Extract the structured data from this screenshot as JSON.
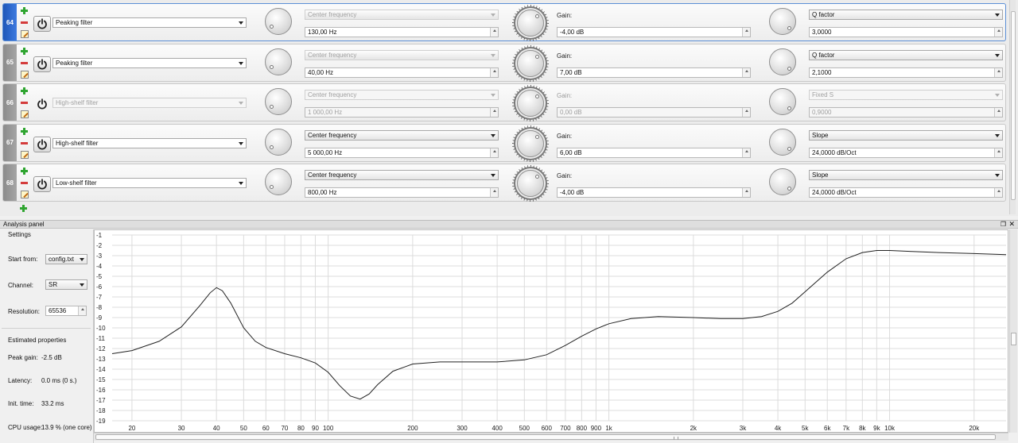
{
  "filters": [
    {
      "index": "64",
      "enabled": true,
      "selected": true,
      "type": "Peaking filter",
      "param1_label": "Center frequency",
      "param1_value": "130,00 Hz",
      "gain_label": "Gain:",
      "gain_value": "-4,00 dB",
      "param3_label": "Q factor",
      "param3_value": "3,0000"
    },
    {
      "index": "65",
      "enabled": true,
      "selected": false,
      "type": "Peaking filter",
      "param1_label": "Center frequency",
      "param1_value": "40,00 Hz",
      "gain_label": "Gain:",
      "gain_value": "7,00 dB",
      "param3_label": "Q factor",
      "param3_value": "2,1000"
    },
    {
      "index": "66",
      "enabled": false,
      "selected": false,
      "type": "High-shelf filter",
      "param1_label": "Center frequency",
      "param1_value": "1 000,00 Hz",
      "gain_label": "Gain:",
      "gain_value": "0,00 dB",
      "param3_label": "Fixed S",
      "param3_value": "0,9000"
    },
    {
      "index": "67",
      "enabled": true,
      "selected": false,
      "type": "High-shelf filter",
      "param1_label": "Center frequency",
      "param1_value": "5 000,00 Hz",
      "gain_label": "Gain:",
      "gain_value": "6,00 dB",
      "param3_label": "Slope",
      "param3_value": "24,0000 dB/Oct"
    },
    {
      "index": "68",
      "enabled": true,
      "selected": false,
      "type": "Low-shelf filter",
      "param1_label": "Center frequency",
      "param1_value": "800,00 Hz",
      "gain_label": "Gain:",
      "gain_value": "-4,00 dB",
      "param3_label": "Slope",
      "param3_value": "24,0000 dB/Oct"
    }
  ],
  "analysis": {
    "title": "Analysis panel",
    "settings_title": "Settings",
    "start_from_label": "Start from:",
    "start_from_value": "config.txt",
    "channel_label": "Channel:",
    "channel_value": "SR",
    "resolution_label": "Resolution:",
    "resolution_value": "65536",
    "estimated_title": "Estimated properties",
    "peak_gain_label": "Peak gain:",
    "peak_gain_value": "-2.5 dB",
    "latency_label": "Latency:",
    "latency_value": "0.0 ms (0 s.)",
    "init_time_label": "Init. time:",
    "init_time_value": "33.2 ms",
    "cpu_label": "CPU usage:",
    "cpu_value": "13.9 % (one core)"
  },
  "colors": {
    "selected_accent": "#2f6fd0",
    "add_green": "#2fa530",
    "remove_red": "#d43c3c"
  },
  "chart_data": {
    "type": "line",
    "x_scale": "log",
    "xlim": [
      17,
      26000
    ],
    "ylim": [
      -19,
      -1
    ],
    "y_ticks": [
      -1,
      -2,
      -3,
      -4,
      -5,
      -6,
      -7,
      -8,
      -9,
      -10,
      -11,
      -12,
      -13,
      -14,
      -15,
      -16,
      -17,
      -18,
      -19
    ],
    "x_ticks": [
      {
        "value": 20,
        "label": "20"
      },
      {
        "value": 30,
        "label": "30"
      },
      {
        "value": 40,
        "label": "40"
      },
      {
        "value": 50,
        "label": "50"
      },
      {
        "value": 60,
        "label": "60"
      },
      {
        "value": 70,
        "label": "70"
      },
      {
        "value": 80,
        "label": "80"
      },
      {
        "value": 90,
        "label": "90"
      },
      {
        "value": 100,
        "label": "100"
      },
      {
        "value": 200,
        "label": "200"
      },
      {
        "value": 300,
        "label": "300"
      },
      {
        "value": 400,
        "label": "400"
      },
      {
        "value": 500,
        "label": "500"
      },
      {
        "value": 600,
        "label": "600"
      },
      {
        "value": 700,
        "label": "700"
      },
      {
        "value": 800,
        "label": "800"
      },
      {
        "value": 900,
        "label": "900"
      },
      {
        "value": 1000,
        "label": "1k"
      },
      {
        "value": 2000,
        "label": "2k"
      },
      {
        "value": 3000,
        "label": "3k"
      },
      {
        "value": 4000,
        "label": "4k"
      },
      {
        "value": 5000,
        "label": "5k"
      },
      {
        "value": 6000,
        "label": "6k"
      },
      {
        "value": 7000,
        "label": "7k"
      },
      {
        "value": 8000,
        "label": "8k"
      },
      {
        "value": 9000,
        "label": "9k"
      },
      {
        "value": 10000,
        "label": "10k"
      },
      {
        "value": 20000,
        "label": "20k"
      }
    ],
    "grid": true,
    "series": [
      {
        "x": [
          17,
          20,
          25,
          30,
          35,
          38,
          40,
          42,
          45,
          50,
          55,
          60,
          70,
          80,
          90,
          100,
          110,
          120,
          130,
          140,
          150,
          170,
          200,
          250,
          300,
          400,
          500,
          600,
          700,
          800,
          900,
          1000,
          1200,
          1500,
          2000,
          2500,
          3000,
          3500,
          4000,
          4500,
          5000,
          6000,
          7000,
          8000,
          9000,
          10000,
          12000,
          15000,
          20000,
          26000
        ],
        "y": [
          -12.5,
          -12.2,
          -11.3,
          -9.9,
          -7.8,
          -6.6,
          -6.1,
          -6.4,
          -7.6,
          -10.0,
          -11.3,
          -11.9,
          -12.5,
          -12.9,
          -13.4,
          -14.3,
          -15.6,
          -16.6,
          -16.9,
          -16.4,
          -15.5,
          -14.2,
          -13.5,
          -13.3,
          -13.3,
          -13.3,
          -13.1,
          -12.6,
          -11.7,
          -10.8,
          -10.1,
          -9.6,
          -9.1,
          -8.9,
          -9.0,
          -9.1,
          -9.1,
          -8.9,
          -8.4,
          -7.6,
          -6.5,
          -4.6,
          -3.3,
          -2.7,
          -2.5,
          -2.5,
          -2.6,
          -2.7,
          -2.8,
          -2.9
        ]
      }
    ]
  }
}
